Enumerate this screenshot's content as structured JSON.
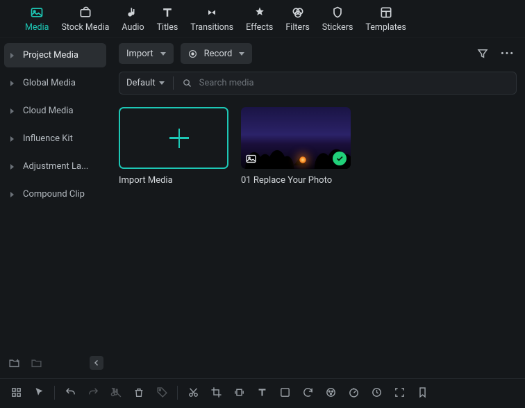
{
  "top_tabs": {
    "media": "Media",
    "stock_media": "Stock Media",
    "audio": "Audio",
    "titles": "Titles",
    "transitions": "Transitions",
    "effects": "Effects",
    "filters": "Filters",
    "stickers": "Stickers",
    "templates": "Templates"
  },
  "sidebar": {
    "items": [
      "Project Media",
      "Global Media",
      "Cloud Media",
      "Influence Kit",
      "Adjustment La...",
      "Compound Clip"
    ]
  },
  "toolbar": {
    "import": "Import",
    "record": "Record"
  },
  "search": {
    "sort": "Default",
    "placeholder": "Search media"
  },
  "media": {
    "import_label": "Import Media",
    "photo_label": "01 Replace Your Photo"
  }
}
